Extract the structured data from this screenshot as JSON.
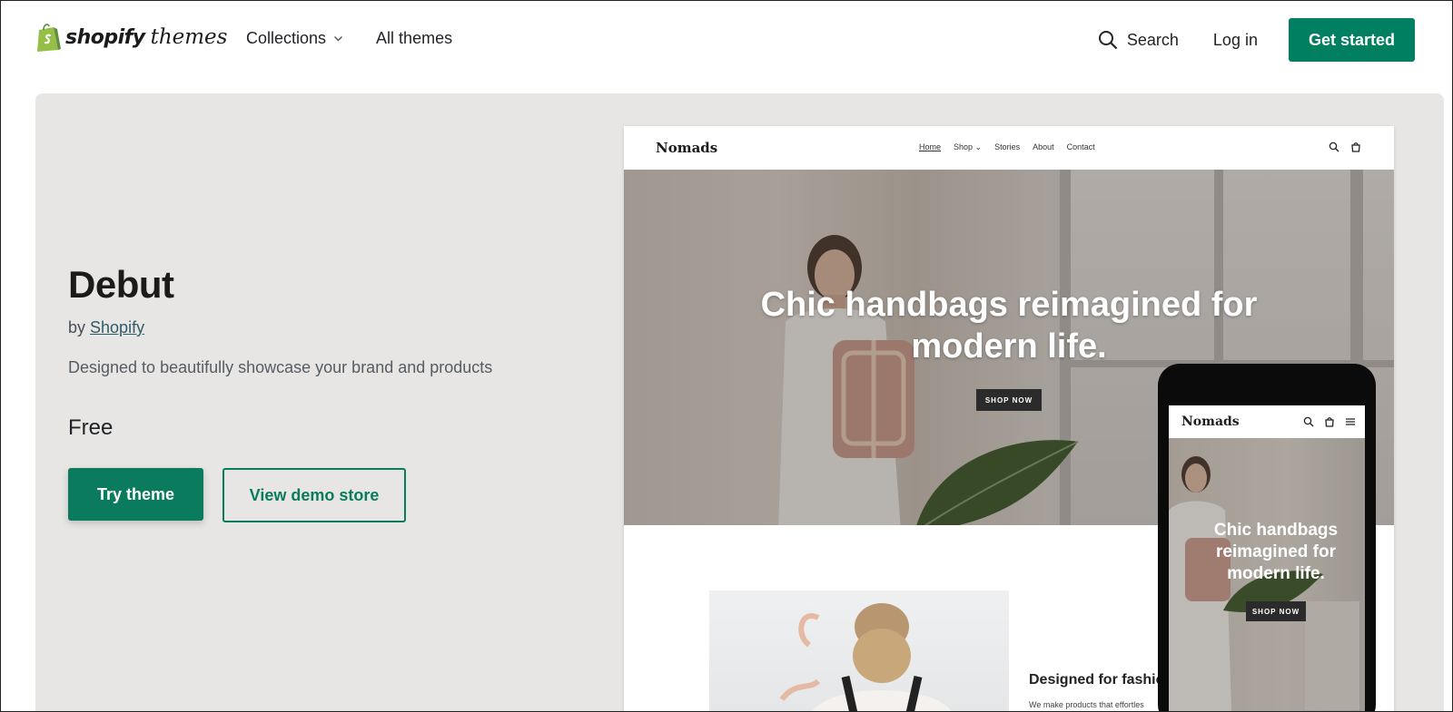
{
  "header": {
    "logo_word": "shopify",
    "logo_suffix": "themes",
    "nav": {
      "collections": "Collections",
      "all_themes": "All themes"
    },
    "search_label": "Search",
    "login_label": "Log in",
    "cta_label": "Get started"
  },
  "theme": {
    "name": "Debut",
    "by_prefix": "by",
    "author": "Shopify",
    "description": "Designed to beautifully showcase your brand and products",
    "price": "Free",
    "try_label": "Try theme",
    "demo_label": "View demo store"
  },
  "preview_desktop": {
    "brand": "Nomads",
    "nav": [
      "Home",
      "Shop",
      "Stories",
      "About",
      "Contact"
    ],
    "headline_line1": "Chic handbags reimagined for",
    "headline_line2": "modern life.",
    "shop_now": "SHOP NOW",
    "subhead": "Designed for fashic",
    "subtext": "We make products that effortles"
  },
  "preview_mobile": {
    "brand": "Nomads",
    "headline_line1": "Chic handbags",
    "headline_line2": "reimagined for",
    "headline_line3": "modern life.",
    "shop_now": "SHOP NOW"
  },
  "colors": {
    "brand_green": "#008060",
    "hero_bg": "#e7e6e4"
  },
  "icons": [
    "shopify-bag-icon",
    "chevron-down-icon",
    "search-icon",
    "cart-icon",
    "menu-icon"
  ]
}
